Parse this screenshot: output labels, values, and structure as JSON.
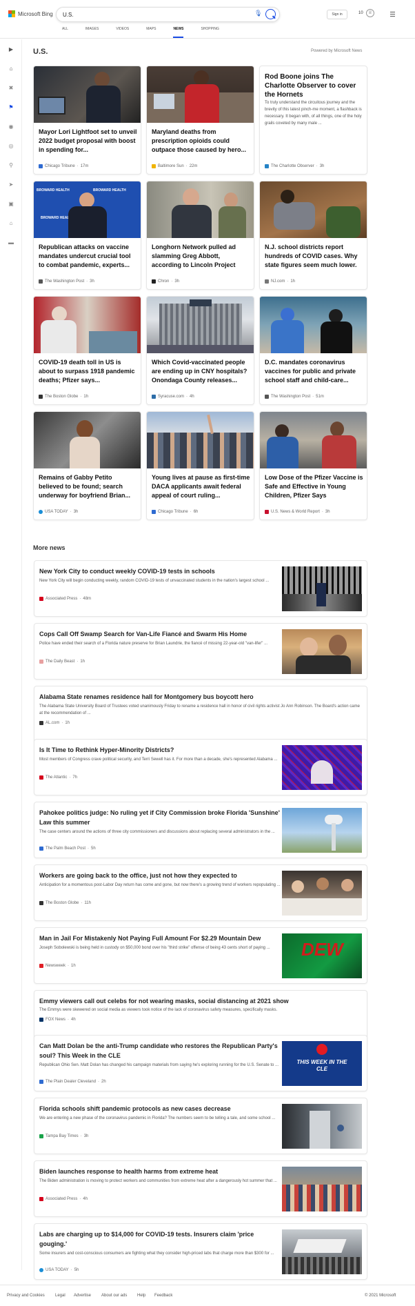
{
  "header": {
    "logo_text": "Microsoft Bing",
    "search": {
      "value": "U.S."
    },
    "signin_label": "Sign in",
    "rewards_points": "10",
    "scopes": [
      {
        "label": "ALL",
        "active": false
      },
      {
        "label": "IMAGES",
        "active": false
      },
      {
        "label": "VIDEOS",
        "active": false
      },
      {
        "label": "MAPS",
        "active": false
      },
      {
        "label": "NEWS",
        "active": true
      },
      {
        "label": "SHOPPING",
        "active": false
      }
    ]
  },
  "sidebar": {
    "icons": [
      "expand-icon",
      "home-icon",
      "tools-icon",
      "flag-icon",
      "location-icon",
      "globe-icon",
      "science-icon",
      "rocket-icon",
      "movie-icon",
      "bank-icon",
      "card-icon"
    ]
  },
  "top_section": {
    "title": "U.S.",
    "powered_by": "Powered by Microsoft News",
    "cards": [
      {
        "title": "Mayor Lori Lightfoot set to unveil 2022 budget proposal with boost in spending for...",
        "source": "Chicago Tribune",
        "time": "17m"
      },
      {
        "title": "Maryland deaths from prescription opioids could outpace those caused by hero...",
        "source": "Baltimore Sun",
        "time": "22m"
      },
      {
        "title": "Rod Boone joins The Charlotte Observer to cover the Hornets",
        "snippet": "To truly understand the circuitous journey and the brevity of this latest pinch-me moment, a flashback is necessary. It began with, of all things, one of the holy grails coveted by many male ...",
        "source": "The Charlotte Observer",
        "time": "3h"
      },
      {
        "title": "Republican attacks on vaccine mandates undercut crucial tool to combat pandemic, experts...",
        "source": "The Washington Post",
        "time": "3h",
        "image_text": "BROWARD HEALTH"
      },
      {
        "title": "Longhorn Network pulled ad slamming Greg Abbott, according to Lincoln Project",
        "source": "Chron",
        "time": "3h"
      },
      {
        "title": "N.J. school districts report hundreds of COVID cases. Why state figures seem much lower.",
        "source": "NJ.com",
        "time": "1h"
      },
      {
        "title": "COVID-19 death toll in US is about to surpass 1918 pandemic deaths; Pfizer says...",
        "source": "The Boston Globe",
        "time": "1h"
      },
      {
        "title": "Which Covid-vaccinated people are ending up in CNY hospitals? Onondaga County releases...",
        "source": "Syracuse.com",
        "time": "4h"
      },
      {
        "title": "D.C. mandates coronavirus vaccines for public and private school staff and child-care...",
        "source": "The Washington Post",
        "time": "51m"
      },
      {
        "title": "Remains of Gabby Petito believed to be found; search underway for boyfriend Brian...",
        "source": "USA TODAY",
        "time": "3h"
      },
      {
        "title": "Young lives at pause as first-time DACA applicants await federal appeal of court ruling...",
        "source": "Chicago Tribune",
        "time": "6h"
      },
      {
        "title": "Low Dose of the Pfizer Vaccine is Safe and Effective in Young Children, Pfizer Says",
        "source": "U.S. News & World Report",
        "time": "3h"
      }
    ]
  },
  "more_news": {
    "title": "More news",
    "articles": [
      {
        "title": "New York City to conduct weekly COVID-19 tests in schools",
        "snippet": "New York City will begin conducting weekly, random COVID-19 tests of unvaccinated students in the nation's largest school ...",
        "source": "Associated Press",
        "time": "48m"
      },
      {
        "title": "Cops Call Off Swamp Search for Van-Life Fiancé and Swarm His Home",
        "snippet": "Police have ended their search of a Florida nature preserve for Brian Laundrie, the fiancé of missing 22-year-old \"van-lifer\" ...",
        "source": "The Daily Beast",
        "time": "1h"
      },
      {
        "title": "Alabama State renames residence hall for Montgomery bus boycott hero",
        "snippet": "The Alabama State University Board of Trustees voted unanimously Friday to rename a residence hall in honor of civil rights activist Jo Ann Robinson. The Board's action came at the recommendation of ...",
        "source": "AL.com",
        "time": "1h"
      },
      {
        "title": "Is It Time to Rethink Hyper-Minority Districts?",
        "snippet": "Most members of Congress crave political security, and Terri Sewell has it. For more than a decade, she's represented Alabama ...",
        "source": "The Atlantic",
        "time": "7h"
      },
      {
        "title": "Pahokee politics judge: No ruling yet if City Commission broke Florida 'Sunshine' Law this summer",
        "snippet": "The case centers around the actions of three city commissioners and discussions about replacing several administrators in the ...",
        "source": "The Palm Beach Post",
        "time": "5h"
      },
      {
        "title": "Workers are going back to the office, just not how they expected to",
        "snippet": "Anticipation for a momentous post-Labor Day return has come and gone, but now there's a growing trend of workers repopulating ...",
        "source": "The Boston Globe",
        "time": "11h"
      },
      {
        "title": "Man in Jail For Mistakenly Not Paying Full Amount For $2.29 Mountain Dew",
        "snippet": "Joseph Sobolewski is being held in custody on $50,000 bond over his \"third strike\" offense of being 43 cents short of paying ...",
        "source": "Newsweek",
        "time": "1h",
        "image_text": "DEW"
      },
      {
        "title": "Emmy viewers call out celebs for not wearing masks, social distancing at 2021 show",
        "snippet": "The Emmys were skewered on social media as viewers took notice of the lack of coronavirus safety measures, specifically masks.",
        "source": "FOX News",
        "time": "4h"
      },
      {
        "title": "Can Matt Dolan be the anti-Trump candidate who restores the Republican Party's soul? This Week in the CLE",
        "snippet": "Republican Ohio Sen. Matt Dolan has changed his campaign materials from saying he's exploring running for the U.S. Senate to ...",
        "source": "The Plain Dealer Cleveland",
        "time": "2h",
        "image_text": "THIS WEEK IN THE CLE"
      },
      {
        "title": "Florida schools shift pandemic protocols as new cases decrease",
        "snippet": "We are entering a new phase of the coronavirus pandemic in Florida? The numbers seem to be telling a tale, and some school ...",
        "source": "Tampa Bay Times",
        "time": "3h"
      },
      {
        "title": "Biden launches response to health harms from extreme heat",
        "snippet": "The Biden administration is moving to protect workers and communities from extreme heat after a dangerously hot summer that ...",
        "source": "Associated Press",
        "time": "4h"
      },
      {
        "title": "Labs are charging up to $14,000 for COVID-19 tests. Insurers claim 'price gouging.'",
        "snippet": "Some insurers and cost-conscious consumers are fighting what they consider high-priced labs that charge more than $300 for ...",
        "source": "USA TODAY",
        "time": "5h"
      }
    ]
  },
  "footer": {
    "links": [
      "Privacy and Cookies",
      "Legal",
      "Advertise",
      "About our ads",
      "Help",
      "Feedback"
    ],
    "copyright": "© 2021 Microsoft"
  },
  "colors": {
    "accent": "#174ae4",
    "ms_red": "#f25022",
    "ms_green": "#7fba00",
    "ms_blue": "#00a4ef",
    "ms_yellow": "#ffb900"
  }
}
